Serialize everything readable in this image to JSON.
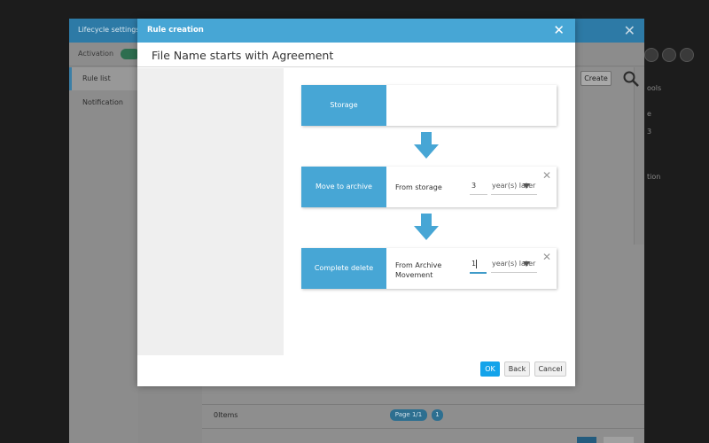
{
  "background": {
    "window_title": "Lifecycle settings",
    "activation_label": "Activation",
    "sidebar": [
      {
        "label": "Rule list",
        "active": true
      },
      {
        "label": "Notification",
        "active": false
      }
    ],
    "create_label": "Create",
    "items_label": "0Items",
    "page_label": "Page 1/1",
    "page_number": "1",
    "right_text": {
      "tools": "ools",
      "e": "e",
      "b": "3",
      "tion": "tion"
    }
  },
  "modal": {
    "title": "Rule creation",
    "subtitle": "File Name starts with Agreement",
    "stages": [
      {
        "label": "Storage"
      },
      {
        "label": "Move to archive",
        "from": "From storage",
        "value": "3",
        "unit": "year(s) later"
      },
      {
        "label": "Complete delete",
        "from_line1": "From Archive",
        "from_line2": "Movement",
        "value": "1",
        "unit": "year(s) later"
      }
    ],
    "buttons": {
      "ok": "OK",
      "back": "Back",
      "cancel": "Cancel"
    }
  },
  "colors": {
    "accent": "#47a6d5",
    "ok_button": "#13a3ea",
    "overlay": "#1c1c1c"
  },
  "icons": [
    "close-icon",
    "search-icon",
    "arrow-down-icon",
    "remove-icon",
    "dropdown-caret-icon"
  ]
}
